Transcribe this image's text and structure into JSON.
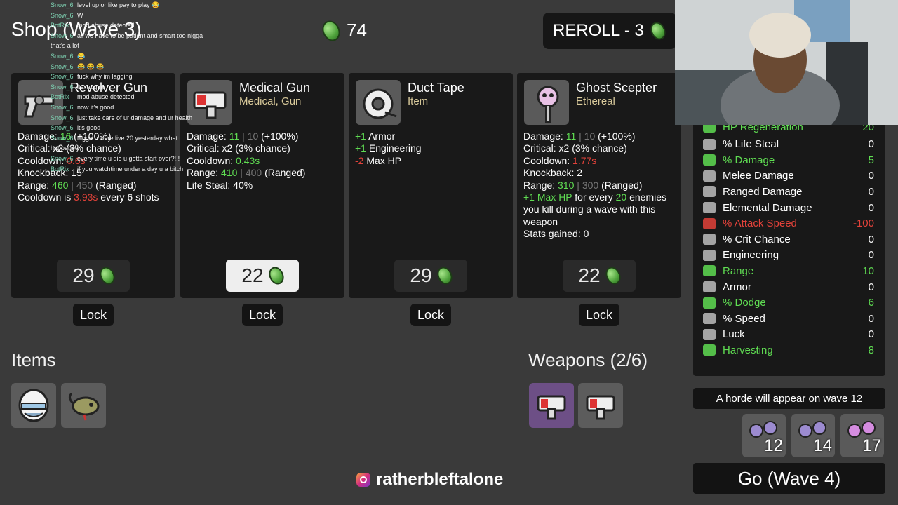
{
  "header": {
    "title": "Shop (Wave 3)",
    "materials": "74",
    "reroll": "REROLL - 3"
  },
  "colors": {
    "coin": "#4fa33c",
    "positive": "#5fdc52",
    "negative": "#e3423a",
    "tier": "#d8c99a"
  },
  "cards": [
    {
      "name": "Revolver Gun",
      "type": "",
      "price": "29",
      "lock": "Lock",
      "icon": "revolver-icon",
      "stats": [
        [
          "Damage: ",
          "16",
          "",
          "(+100%)"
        ],
        [
          "Critical: x2 (3% chance)"
        ],
        [
          "Cooldown: ",
          "0.6s"
        ],
        [
          "Knockback: 15"
        ],
        [
          "Range: ",
          "460",
          "450",
          "(Ranged)"
        ],
        [
          "Cooldown is ",
          "3.93s",
          " every 6 shots"
        ]
      ]
    },
    {
      "name": "Medical Gun",
      "type": "Medical, Gun",
      "price": "22",
      "lock": "Lock",
      "icon": "medical-gun-icon",
      "stats": [
        [
          "Damage: ",
          "11",
          "10",
          "(+100%)"
        ],
        [
          "Critical: x2 (3% chance)"
        ],
        [
          "Cooldown: ",
          "0.43s"
        ],
        [
          "Range: ",
          "410",
          "400",
          "(Ranged)"
        ],
        [
          "Life Steal: 40%"
        ]
      ]
    },
    {
      "name": "Duct Tape",
      "type": "Item",
      "price": "29",
      "lock": "Lock",
      "icon": "duct-tape-icon",
      "stats": [
        [
          "+1",
          " Armor"
        ],
        [
          "+1",
          " Engineering"
        ],
        [
          "-2",
          " Max HP"
        ]
      ]
    },
    {
      "name": "Ghost Scepter",
      "type": "Ethereal",
      "price": "22",
      "lock": "Lock",
      "icon": "ghost-scepter-icon",
      "stats": [
        [
          "Damage: ",
          "11",
          "10",
          "(+100%)"
        ],
        [
          "Critical: x2 (3% chance)"
        ],
        [
          "Cooldown: ",
          "1.77s"
        ],
        [
          "Knockback: 2"
        ],
        [
          "Range: ",
          "310",
          "300",
          "(Ranged)"
        ],
        [
          "+1 Max HP",
          " for every ",
          "20",
          " enemies you kill during a wave with this weapon"
        ],
        [
          "Stats gained: 0"
        ]
      ]
    }
  ],
  "sections": {
    "items": "Items",
    "weapons": "Weapons (2/6)"
  },
  "stats": [
    {
      "label": "HP Regeneration",
      "value": "20",
      "color": "#5fdc52",
      "icon": "hp-regen-icon"
    },
    {
      "label": "% Life Steal",
      "value": "0",
      "color": "#ffffff",
      "icon": "life-steal-icon"
    },
    {
      "label": "% Damage",
      "value": "5",
      "color": "#5fdc52",
      "icon": "damage-icon"
    },
    {
      "label": "Melee Damage",
      "value": "0",
      "color": "#ffffff",
      "icon": "melee-icon"
    },
    {
      "label": "Ranged Damage",
      "value": "0",
      "color": "#ffffff",
      "icon": "ranged-icon"
    },
    {
      "label": "Elemental Damage",
      "value": "0",
      "color": "#ffffff",
      "icon": "elemental-icon"
    },
    {
      "label": "% Attack Speed",
      "value": "-100",
      "color": "#e3423a",
      "icon": "attack-speed-icon"
    },
    {
      "label": "% Crit Chance",
      "value": "0",
      "color": "#ffffff",
      "icon": "crit-icon"
    },
    {
      "label": "Engineering",
      "value": "0",
      "color": "#ffffff",
      "icon": "engineering-icon"
    },
    {
      "label": "Range",
      "value": "10",
      "color": "#5fdc52",
      "icon": "range-icon"
    },
    {
      "label": "Armor",
      "value": "0",
      "color": "#ffffff",
      "icon": "armor-icon"
    },
    {
      "label": "% Dodge",
      "value": "6",
      "color": "#5fdc52",
      "icon": "dodge-icon"
    },
    {
      "label": "% Speed",
      "value": "0",
      "color": "#ffffff",
      "icon": "speed-icon"
    },
    {
      "label": "Luck",
      "value": "0",
      "color": "#ffffff",
      "icon": "luck-icon"
    },
    {
      "label": "Harvesting",
      "value": "8",
      "color": "#5fdc52",
      "icon": "harvesting-icon"
    }
  ],
  "horde": "A horde will appear on wave 12",
  "enemies": [
    "12",
    "14",
    "17"
  ],
  "go": "Go (Wave 4)",
  "handle": "ratherbleftalone",
  "chat": [
    [
      "Snow_6",
      "level up or like pay to play 😂"
    ],
    [
      "Snow_6",
      "W"
    ],
    [
      "BotRix",
      "mod abuse detected"
    ],
    [
      "Snow_6",
      "all we have to be patient and smart too nigga that's a lot"
    ],
    [
      "Snow_6",
      "😂"
    ],
    [
      "Snow_6",
      "😂 😂 😂"
    ],
    [
      "Snow_6",
      "fuck why im lagging"
    ],
    [
      "Snow_6",
      "its lagging"
    ],
    [
      "BotRix",
      "mod abuse detected"
    ],
    [
      "Snow_6",
      "now it's good"
    ],
    [
      "Snow_6",
      "just take care of ur damage and ur health"
    ],
    [
      "Snow_6",
      "it's good"
    ],
    [
      "Snow_6",
      "nigga u were live 20 yesterday what happened"
    ],
    [
      "Snow_6",
      "every time u die u gotta start over?!!!"
    ],
    [
      "BotRix",
      "if you watchtime under a day u a bitch"
    ]
  ]
}
